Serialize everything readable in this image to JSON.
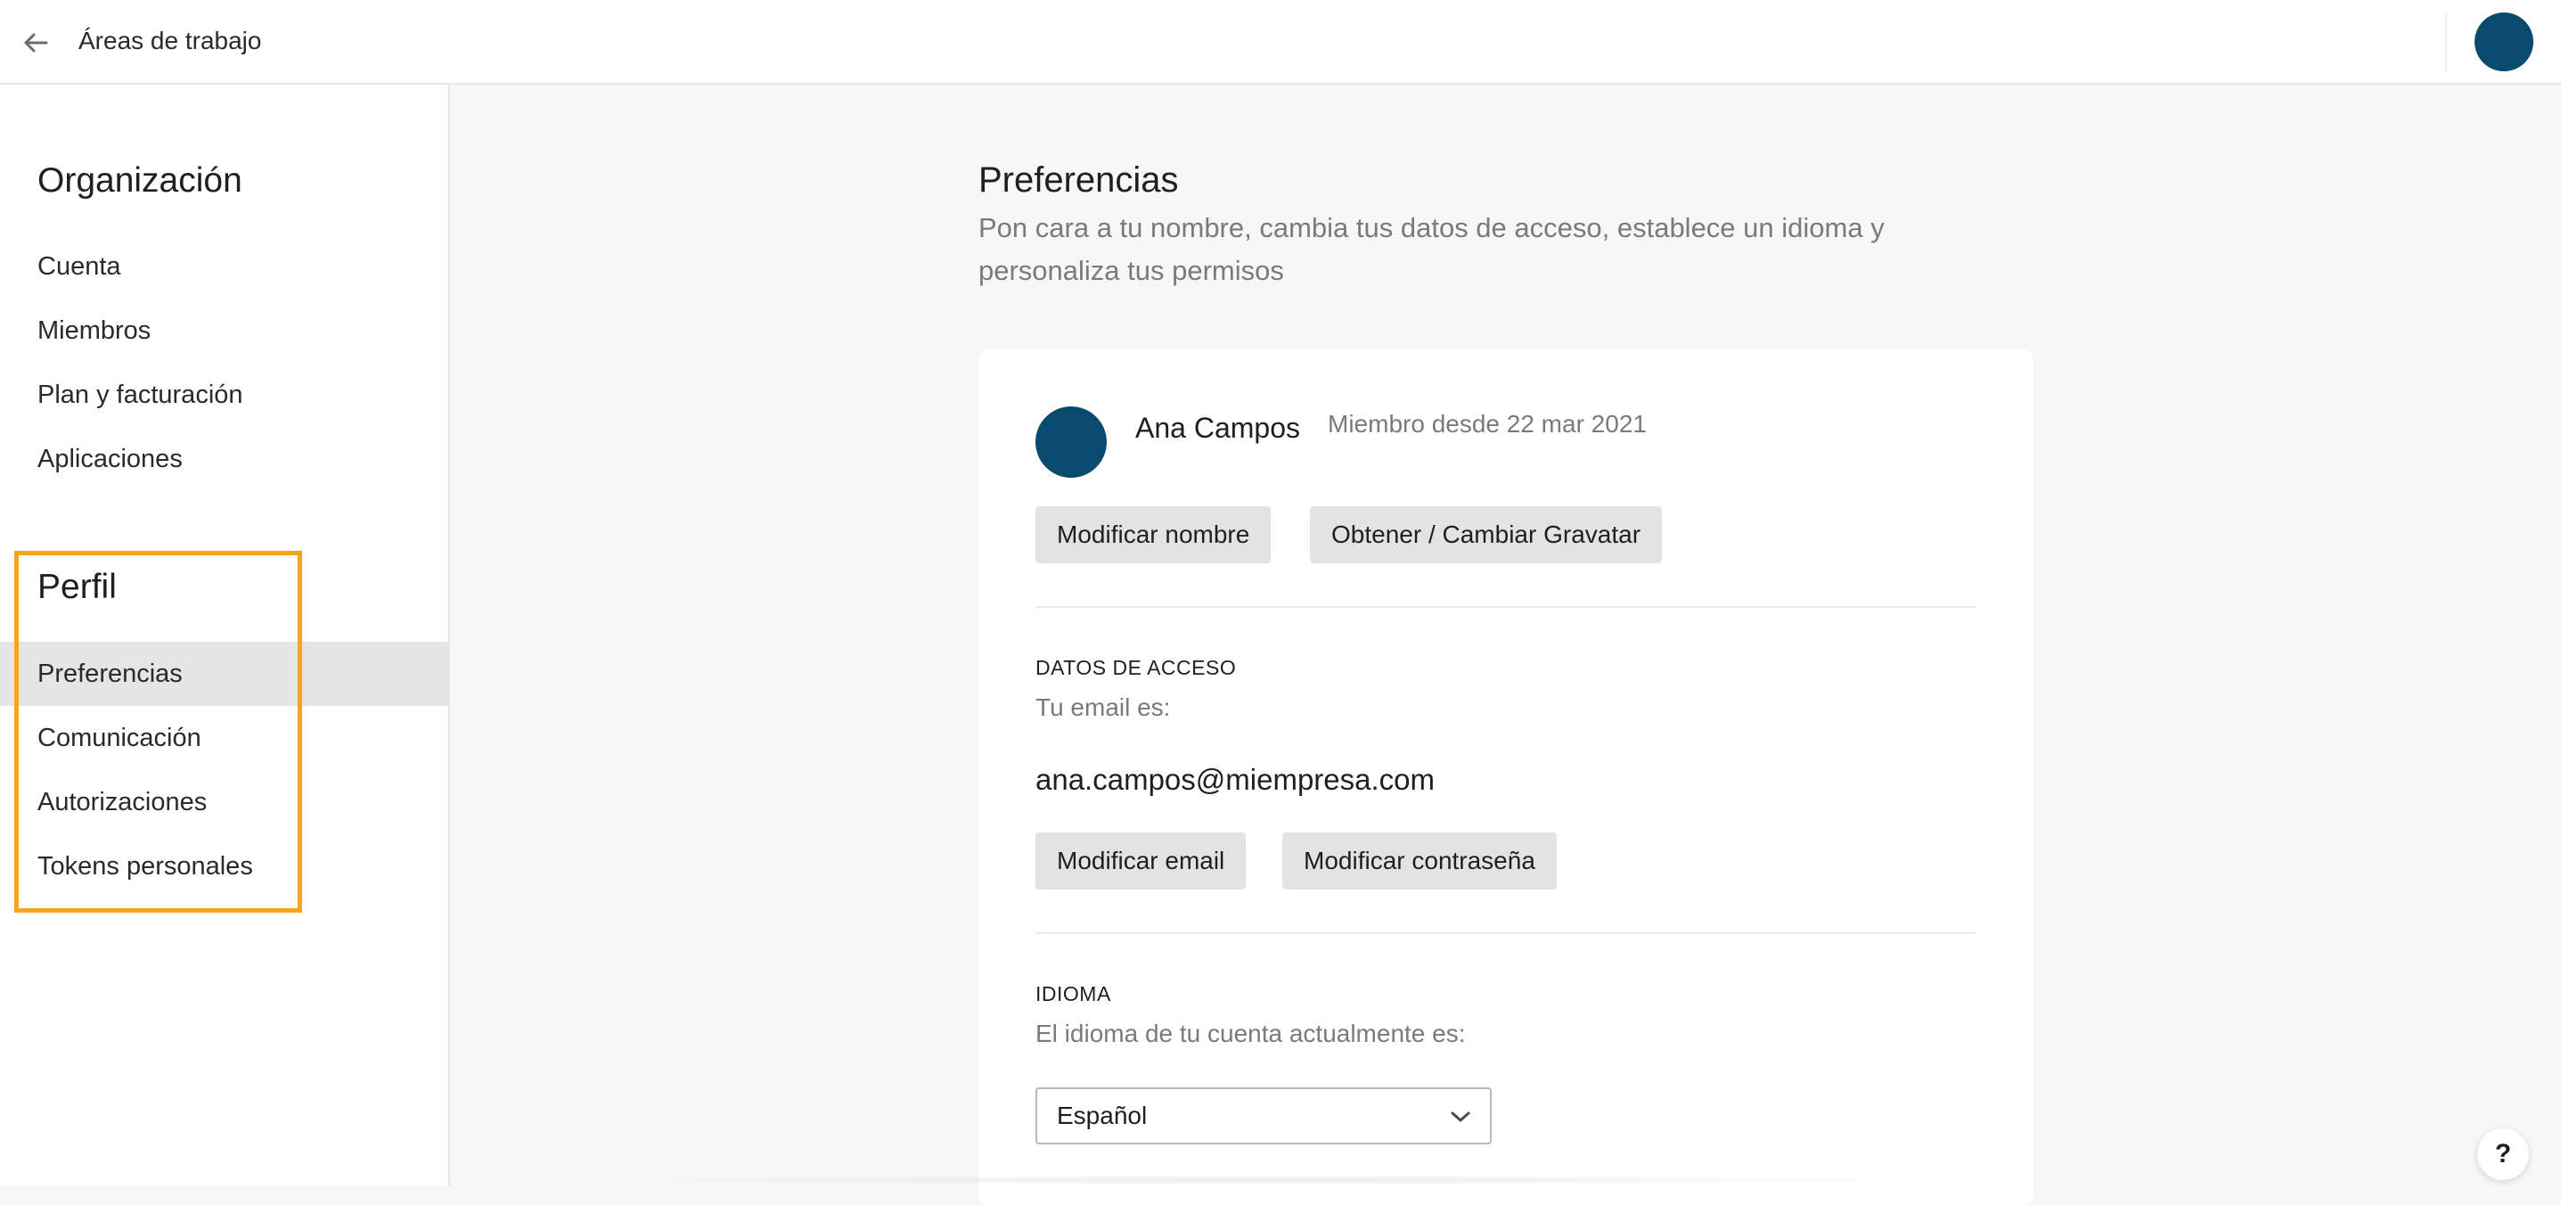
{
  "topbar": {
    "title": "Áreas de trabajo",
    "back_icon": "arrow-left-icon"
  },
  "sidebar": {
    "organization": {
      "heading": "Organización",
      "items": [
        "Cuenta",
        "Miembros",
        "Plan y facturación",
        "Aplicaciones"
      ]
    },
    "profile": {
      "heading": "Perfil",
      "items": [
        "Preferencias",
        "Comunicación",
        "Autorizaciones",
        "Tokens personales"
      ],
      "active": "Preferencias"
    },
    "highlight_color": "#f4a71d"
  },
  "main": {
    "title": "Preferencias",
    "subtitle": "Pon cara a tu nombre, cambia tus datos de acceso, establece un idioma y personaliza tus permisos"
  },
  "profile_card": {
    "user_name": "Ana Campos",
    "member_since": "Miembro desde 22 mar 2021",
    "modify_name_label": "Modificar nombre",
    "gravatar_label": "Obtener / Cambiar Gravatar"
  },
  "access": {
    "heading": "DATOS DE ACCESO",
    "email_hint": "Tu email es:",
    "email": "ana.campos@miempresa.com",
    "modify_email_label": "Modificar email",
    "modify_password_label": "Modificar contraseña"
  },
  "language": {
    "heading": "IDIOMA",
    "hint": "El idioma de tu cuenta actualmente es:",
    "selected": "Español"
  },
  "help": {
    "label": "?"
  },
  "colors": {
    "avatar": "#0b4a6f",
    "active_item_bg": "#e5e5e5",
    "button_bg": "#e3e3e3"
  }
}
